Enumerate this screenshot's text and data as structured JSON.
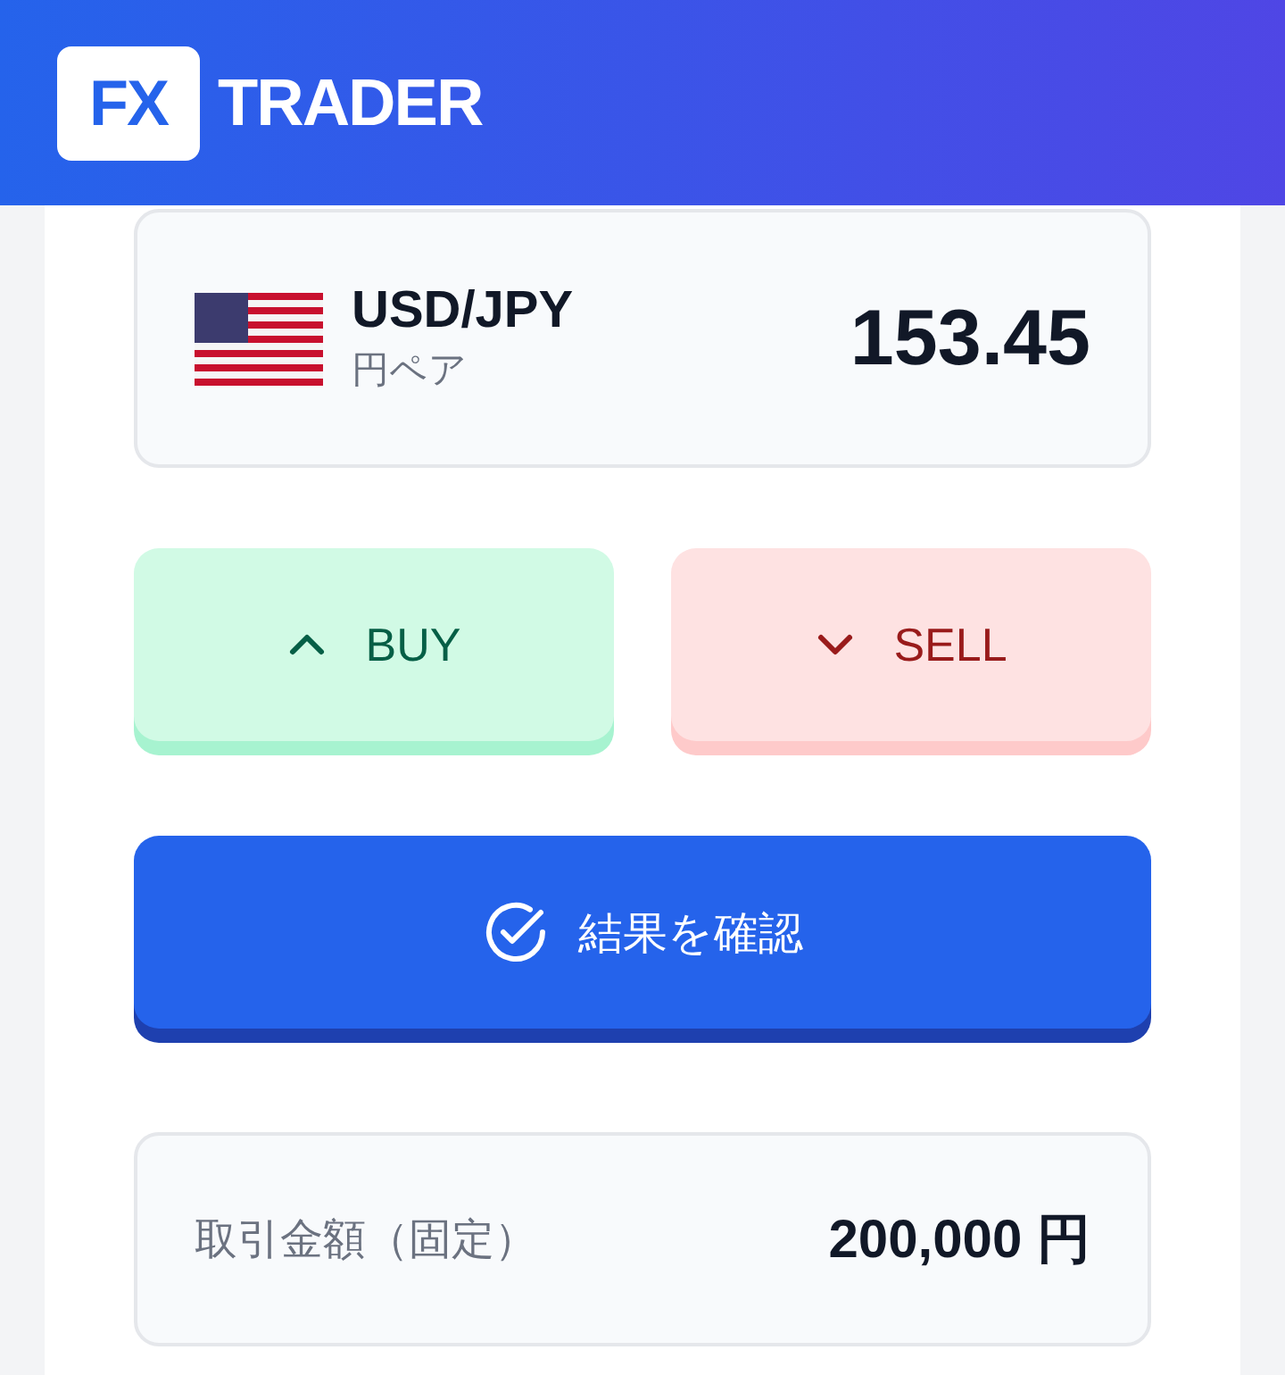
{
  "header": {
    "logo_mark": "FX",
    "logo_text": "TRADER"
  },
  "quote": {
    "pair": "USD/JPY",
    "subtitle": "円ペア",
    "price": "153.45"
  },
  "trade_buttons": [
    {
      "kind": "buy",
      "label": "BUY"
    },
    {
      "kind": "sell",
      "label": "SELL"
    }
  ],
  "confirm_button": {
    "label": "結果を確認"
  },
  "amount": {
    "label": "取引金額（固定）",
    "value": "200,000 円"
  }
}
